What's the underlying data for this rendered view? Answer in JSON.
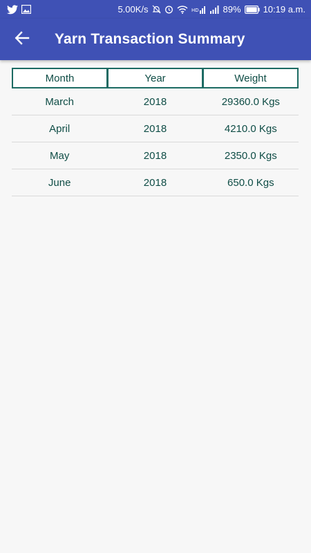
{
  "status_bar": {
    "network_speed": "5.00K/s",
    "battery": "89%",
    "time": "10:19 a.m."
  },
  "app_bar": {
    "title": "Yarn Transaction Summary",
    "back_icon": "arrow-back-icon"
  },
  "colors": {
    "primary": "#3f51b5",
    "table_border": "#1c6b63",
    "table_text": "#0f4d46",
    "background": "#f7f7f7"
  },
  "table": {
    "headers": [
      "Month",
      "Year",
      "Weight"
    ],
    "rows": [
      [
        "March",
        "2018",
        "29360.0 Kgs"
      ],
      [
        "April",
        "2018",
        "4210.0 Kgs"
      ],
      [
        "May",
        "2018",
        "2350.0 Kgs"
      ],
      [
        "June",
        "2018",
        "650.0 Kgs"
      ]
    ]
  }
}
